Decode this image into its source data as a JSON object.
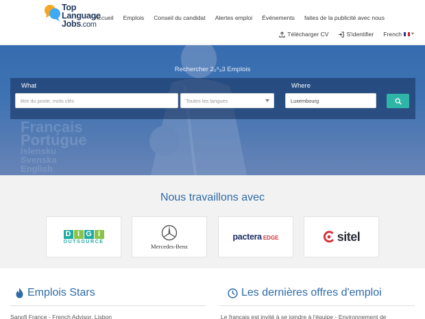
{
  "header": {
    "logo": {
      "line1": "Top",
      "line2": "Language",
      "line3": "Jobs",
      "suffix": ".com"
    },
    "nav": [
      {
        "label": "Accueil"
      },
      {
        "label": "Emplois"
      },
      {
        "label": "Conseil du candidat"
      },
      {
        "label": "Alertes emploi"
      },
      {
        "label": "Événements"
      },
      {
        "label": "faites de la publicité avec nous"
      }
    ],
    "upload_cv": "Télécharger CV",
    "login": "S'identifier",
    "language": "French"
  },
  "hero": {
    "title": "Rechercher 2₀⁸₉3 Emplois",
    "background_words": [
      "Français",
      "Portugue",
      "Íslensku",
      "Svenska",
      "English"
    ],
    "what_label": "What",
    "where_label": "Where",
    "keyword_placeholder": "titre du poste, mots clés",
    "language_select": "Toutes les langues",
    "location_value": "Luxembourg",
    "search_icon": "search-icon"
  },
  "partners": {
    "title": "Nous travaillons avec",
    "digi": {
      "letters": [
        "D",
        "I",
        "G",
        "I"
      ],
      "colors": [
        "#21a9a2",
        "#8bc34a",
        "#21a9a2",
        "#8bc34a"
      ],
      "sub": "OUTSOURCE"
    },
    "mercedes": {
      "name": "Mercedes-Benz"
    },
    "pactera": {
      "name": "pactera",
      "suffix": "EDGE"
    },
    "sitel": {
      "name": "sitel"
    }
  },
  "sections": {
    "stars_title": "Emplois Stars",
    "stars_snippet": "Sanofi France - French Advisor, Lisbon",
    "latest_title": "Les dernières offres d'emploi",
    "latest_snippet": "Le français est invité à se joindre à l'équipe - Environnement de"
  },
  "colors": {
    "brand_navy": "#22395b",
    "accent_blue": "#2e6aa6",
    "button_teal": "#2fb5a7",
    "logo_orange": "#f5a623",
    "logo_blue": "#3fa9f5"
  }
}
